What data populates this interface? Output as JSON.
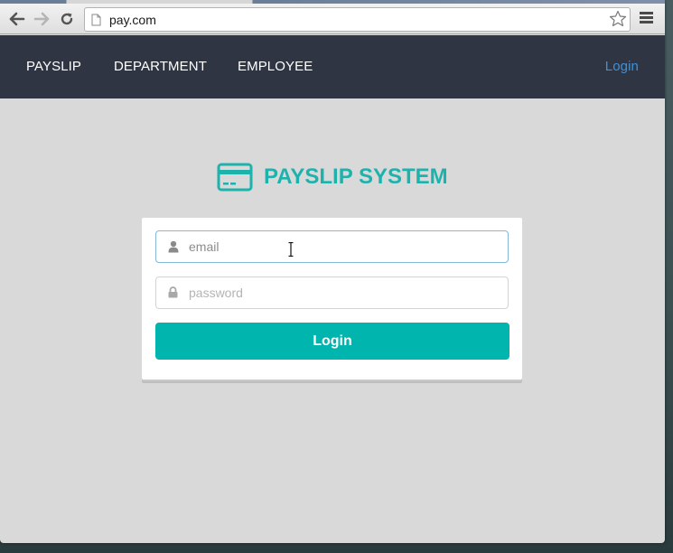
{
  "browser": {
    "url": "pay.com",
    "icons": {
      "back": "arrow-left-icon",
      "forward": "arrow-right-icon",
      "reload": "reload-icon",
      "page": "page-icon",
      "bookmark": "star-icon",
      "menu": "hamburger-menu-icon"
    }
  },
  "navbar": {
    "items": [
      {
        "label": "PAYSLIP"
      },
      {
        "label": "DEPARTMENT"
      },
      {
        "label": "EMPLOYEE"
      }
    ],
    "login_label": "Login"
  },
  "brand": {
    "title": "PAYSLIP SYSTEM",
    "icon": "credit-card-icon"
  },
  "login_form": {
    "email": {
      "value": "",
      "placeholder": "email",
      "icon": "user-icon"
    },
    "password": {
      "value": "",
      "placeholder": "password",
      "icon": "lock-icon"
    },
    "submit_label": "Login"
  },
  "colors": {
    "navbar_bg": "#2f3542",
    "accent": "#00b5ad",
    "brand_text": "#1db3ac",
    "login_link": "#3d92d8",
    "page_bg": "#d9d9d9"
  }
}
